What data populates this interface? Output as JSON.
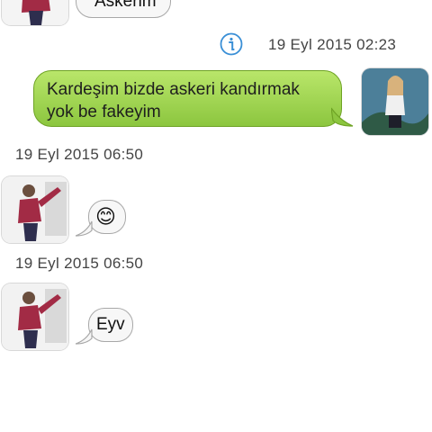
{
  "messages": {
    "partial_top_text": "Askerim",
    "info_timestamp": "19 Eyl 2015 02:23",
    "outgoing_text_line1": "Kardeşim bizde askeri kandırmak",
    "outgoing_text_line2": "yok be fakeyim",
    "timestamp_1": "19 Eyl 2015 06:50",
    "emoji_reply": "😊",
    "timestamp_2": "19 Eyl 2015 06:50",
    "last_reply": "Eyv"
  },
  "icons": {
    "info": "info-icon"
  },
  "colors": {
    "outgoing_bubble": "#8cc63f",
    "incoming_bubble": "#f7f7f7",
    "info_icon": "#3a8fd6"
  }
}
